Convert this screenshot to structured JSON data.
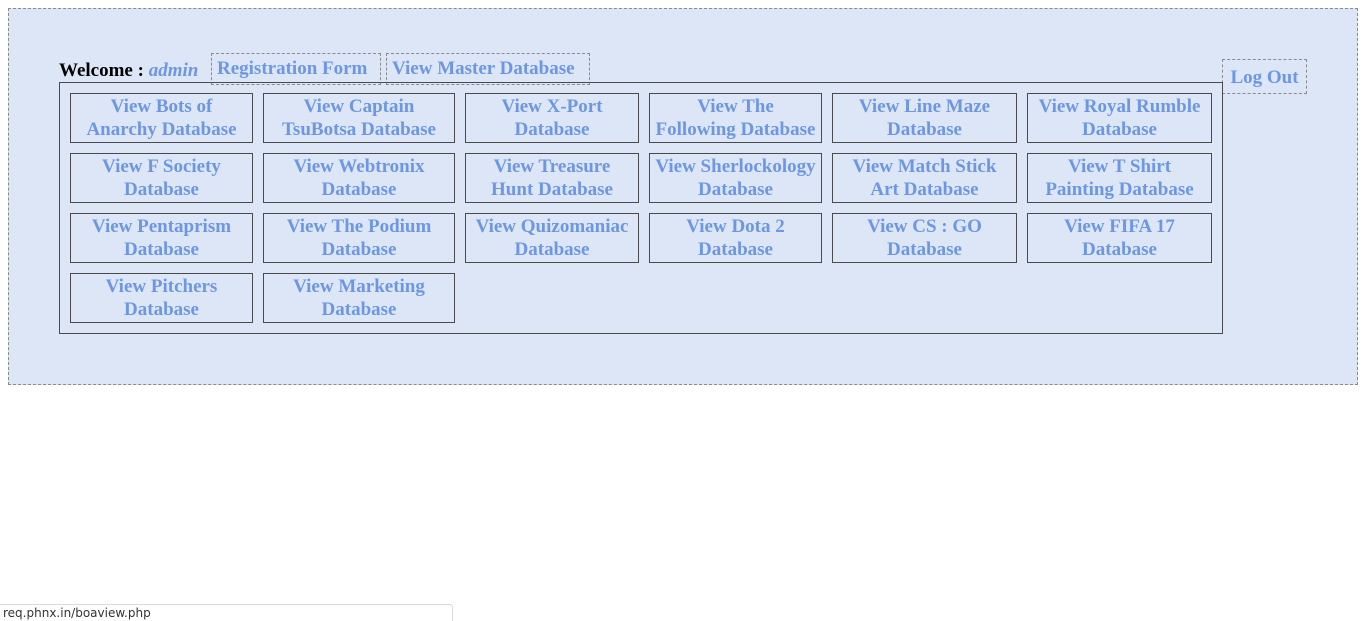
{
  "header": {
    "welcome_label": "Welcome :",
    "username": "admin",
    "registration_form": "Registration Form",
    "view_master_database": "View Master Database",
    "log_out": "Log Out"
  },
  "databases": [
    [
      "View Bots of",
      "Anarchy Database"
    ],
    [
      "View Captain",
      "TsuBotsa Database"
    ],
    [
      "View X-Port",
      "Database"
    ],
    [
      "View The",
      "Following Database"
    ],
    [
      "View Line Maze",
      "Database"
    ],
    [
      "View Royal Rumble",
      "Database"
    ],
    [
      "View F Society",
      "Database"
    ],
    [
      "View Webtronix",
      "Database"
    ],
    [
      "View Treasure",
      "Hunt Database"
    ],
    [
      "View Sherlockology",
      "Database"
    ],
    [
      "View Match Stick",
      "Art Database"
    ],
    [
      "View T Shirt",
      "Painting Database"
    ],
    [
      "View Pentaprism",
      "Database"
    ],
    [
      "View The Podium",
      "Database"
    ],
    [
      "View Quizomaniac",
      "Database"
    ],
    [
      "View Dota 2",
      "Database"
    ],
    [
      "View CS : GO",
      "Database"
    ],
    [
      "View FIFA 17",
      "Database"
    ],
    [
      "View Pitchers",
      "Database"
    ],
    [
      "View Marketing",
      "Database"
    ]
  ],
  "status_bar": {
    "url": "req.phnx.in/boaview.php"
  },
  "colors": {
    "panel_background": "#dce6f6",
    "link": "#6d97e2"
  }
}
